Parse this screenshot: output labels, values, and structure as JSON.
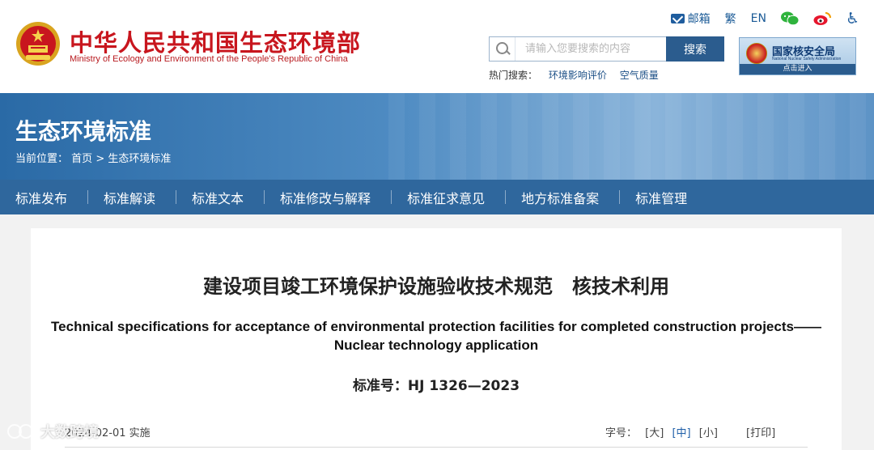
{
  "header": {
    "title": "中华人民共和国生态环境部",
    "subtitle": "Ministry of Ecology and Environment of the People's Republic of China",
    "toplinks": {
      "mail": "邮箱",
      "traditional": "繁",
      "english": "EN"
    },
    "search": {
      "placeholder": "请输入您要搜索的内容",
      "button": "搜索",
      "hot_label": "热门搜索：",
      "hot_links": [
        "环境影响评价",
        "空气质量"
      ]
    },
    "nnsa": {
      "title": "国家核安全局",
      "subtitle": "National Nuclear Safety Administration",
      "action": "点击进入"
    }
  },
  "banner": {
    "title": "生态环境标准",
    "breadcrumb": {
      "label": "当前位置：",
      "home": "首页",
      "separator": ">",
      "current": "生态环境标准"
    }
  },
  "nav": {
    "items": [
      "标准发布",
      "标准解读",
      "标准文本",
      "标准修改与解释",
      "标准征求意见",
      "地方标准备案",
      "标准管理"
    ]
  },
  "document": {
    "title_cn": "建设项目竣工环境保护设施验收技术规范　核技术利用",
    "title_en": "Technical specifications for acceptance of environmental protection facilities for completed construction projects——Nuclear technology application",
    "number": "标准号：HJ 1326—2023",
    "effective": "2024-02-01 实施",
    "font_size_label": "字号：",
    "font_sizes": [
      "[大]",
      "[中]",
      "[小]"
    ],
    "print": "[打印]"
  },
  "watermark": {
    "text": "大数跨境"
  },
  "colors": {
    "brand_red": "#c8161e",
    "nav_blue": "#2f679d",
    "accent_blue": "#1e5fa8"
  },
  "icons": {
    "mail": "mail-icon",
    "wechat": "wechat-icon",
    "weibo": "weibo-icon",
    "accessibility": "accessibility-icon",
    "search": "search-icon"
  }
}
